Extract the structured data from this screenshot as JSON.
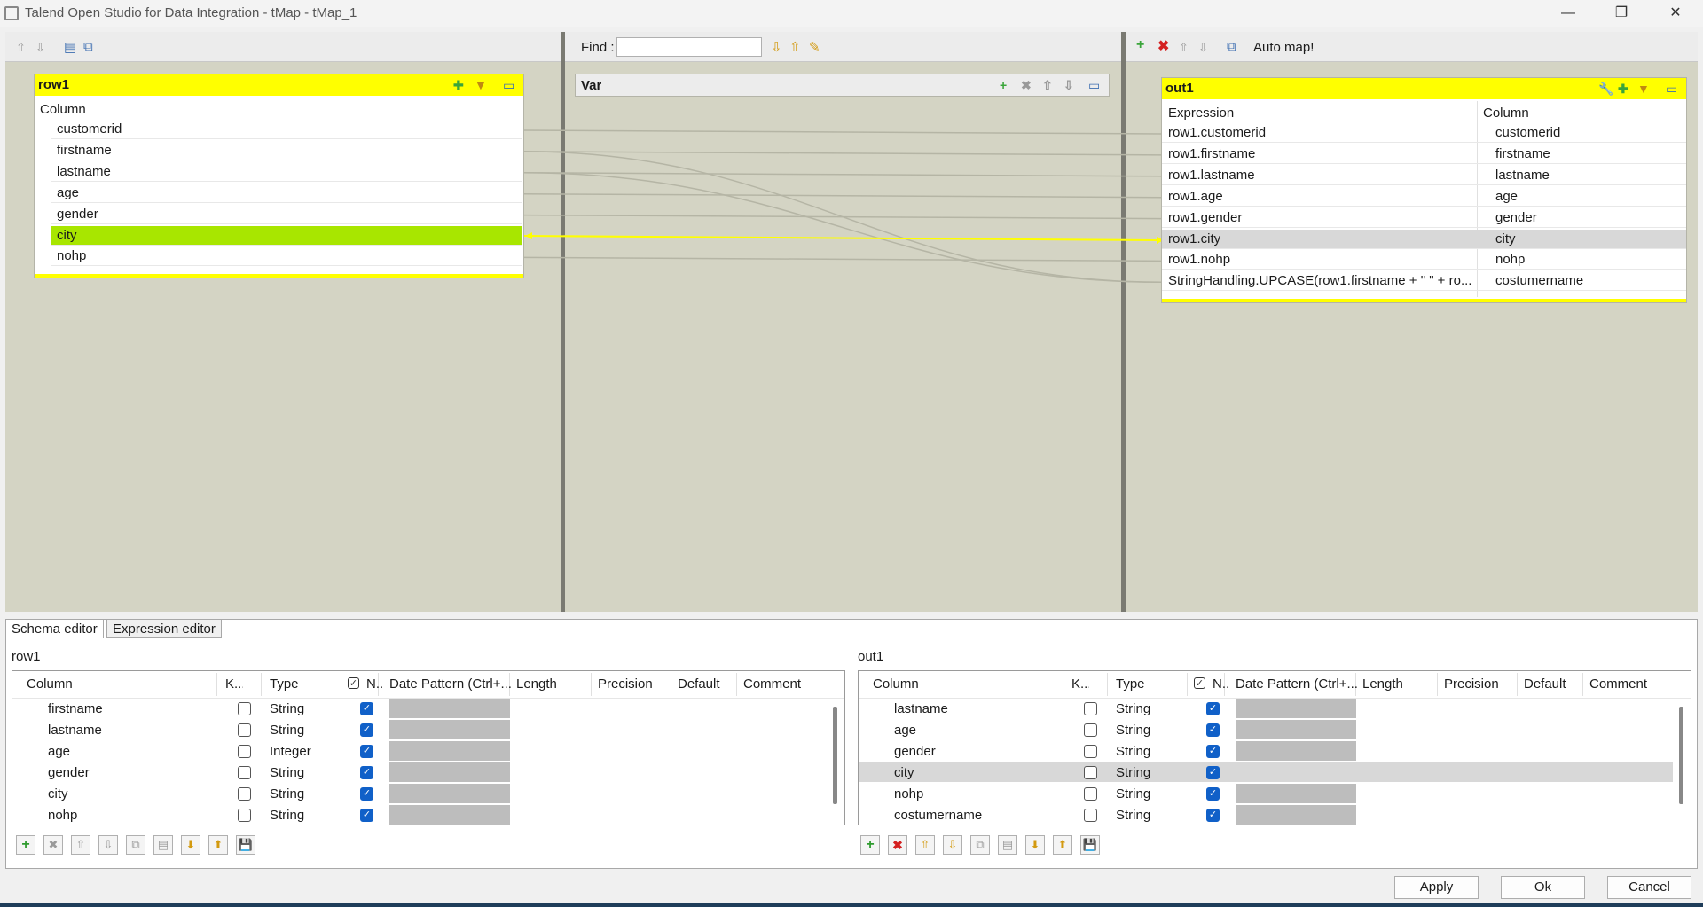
{
  "window": {
    "title": "Talend Open Studio for Data Integration - tMap - tMap_1"
  },
  "left_panel": {
    "table": {
      "name": "row1",
      "header": "Column",
      "columns": [
        "customerid",
        "firstname",
        "lastname",
        "age",
        "gender",
        "city",
        "nohp"
      ],
      "selected": "city"
    }
  },
  "center_panel": {
    "find_label": "Find :",
    "var_title": "Var"
  },
  "right_panel": {
    "auto_map": "Auto map!",
    "table": {
      "name": "out1",
      "header_expression": "Expression",
      "header_column": "Column",
      "rows": [
        {
          "expression": "row1.customerid",
          "column": "customerid"
        },
        {
          "expression": "row1.firstname",
          "column": "firstname"
        },
        {
          "expression": "row1.lastname",
          "column": "lastname"
        },
        {
          "expression": "row1.age",
          "column": "age"
        },
        {
          "expression": "row1.gender",
          "column": "gender"
        },
        {
          "expression": "row1.city",
          "column": "city"
        },
        {
          "expression": "row1.nohp",
          "column": "nohp"
        },
        {
          "expression": "StringHandling.UPCASE(row1.firstname + \" \" + ro...",
          "column": "costumername"
        }
      ],
      "selected": "city"
    }
  },
  "tabs": {
    "schema_editor": "Schema editor",
    "expression_editor": "Expression editor"
  },
  "schema_headers": [
    "Column",
    "K...",
    "Type",
    "N...",
    "Date Pattern (Ctrl+...",
    "Length",
    "Precision",
    "Default",
    "Comment"
  ],
  "schema_left": {
    "title": "row1",
    "rows": [
      {
        "column": "firstname",
        "type": "String"
      },
      {
        "column": "lastname",
        "type": "String"
      },
      {
        "column": "age",
        "type": "Integer"
      },
      {
        "column": "gender",
        "type": "String"
      },
      {
        "column": "city",
        "type": "String"
      },
      {
        "column": "nohp",
        "type": "String"
      }
    ]
  },
  "schema_right": {
    "title": "out1",
    "rows": [
      {
        "column": "lastname",
        "type": "String"
      },
      {
        "column": "age",
        "type": "String"
      },
      {
        "column": "gender",
        "type": "String"
      },
      {
        "column": "city",
        "type": "String"
      },
      {
        "column": "nohp",
        "type": "String"
      },
      {
        "column": "costumername",
        "type": "String"
      }
    ],
    "selected": "city"
  },
  "buttons": {
    "apply": "Apply",
    "ok": "Ok",
    "cancel": "Cancel"
  },
  "colors": {
    "header_yellow": "#ffff00",
    "selected_green": "#a8e600",
    "panel_bg": "#d4d4c4",
    "link_yellow": "#ffff00"
  }
}
